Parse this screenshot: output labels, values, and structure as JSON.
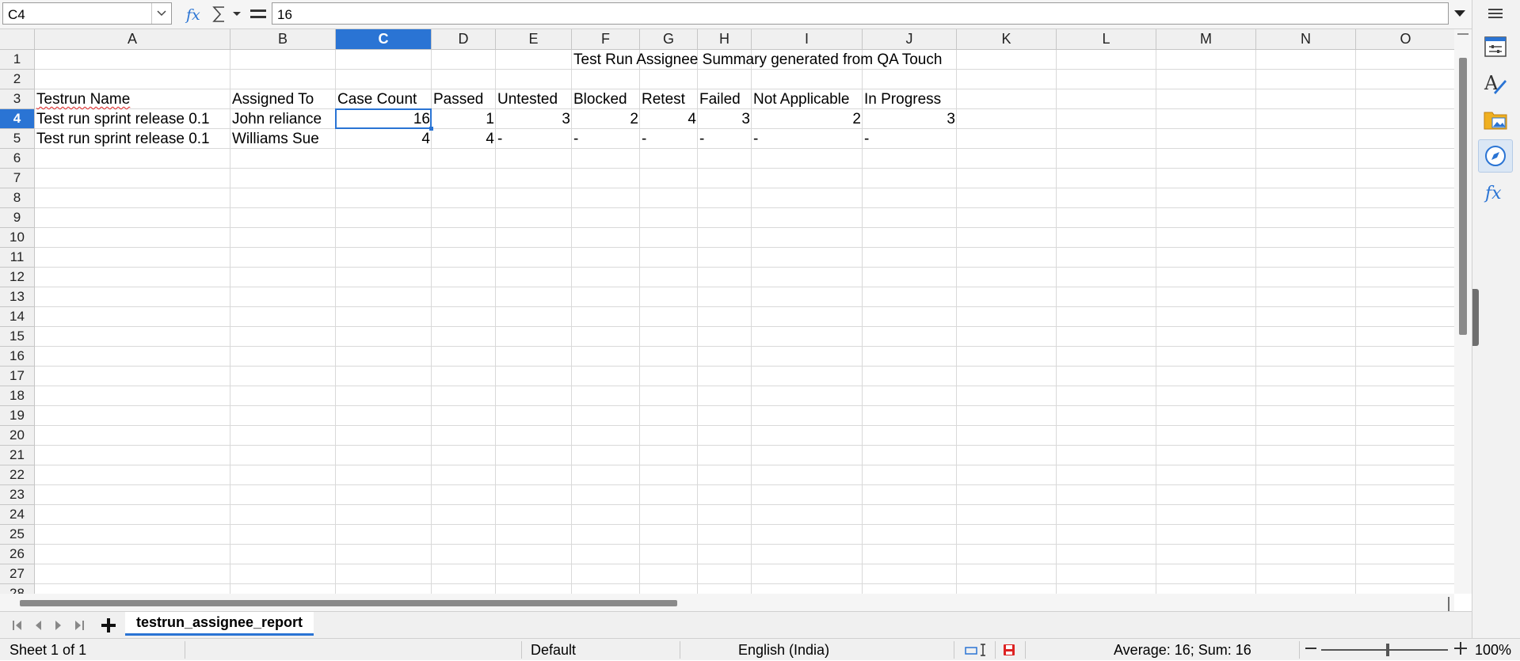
{
  "formula_bar": {
    "cell_ref": "C4",
    "formula_value": "16"
  },
  "columns": [
    "A",
    "B",
    "C",
    "D",
    "E",
    "F",
    "G",
    "H",
    "I",
    "J",
    "K",
    "L",
    "M",
    "N",
    "O"
  ],
  "selected_column": "C",
  "rows": [
    "1",
    "2",
    "3",
    "4",
    "5",
    "6",
    "7",
    "8",
    "9",
    "10",
    "11",
    "12",
    "13",
    "14",
    "15",
    "16",
    "17",
    "18",
    "19",
    "20",
    "21",
    "22",
    "23",
    "24",
    "25",
    "26",
    "27",
    "28"
  ],
  "selected_row": "4",
  "cells": {
    "title": "Test Run Assignee Summary generated from QA Touch",
    "headers": [
      "Testrun Name",
      "Assigned To",
      "Case Count",
      "Passed",
      "Untested",
      "Blocked",
      "Retest",
      "Failed",
      "Not Applicable",
      "In Progress"
    ],
    "data_rows": [
      [
        "Test run sprint release 0.1",
        "John reliance",
        "16",
        "1",
        "3",
        "2",
        "4",
        "3",
        "2",
        "3"
      ],
      [
        "Test run sprint release 0.1",
        "Williams Sue",
        "4",
        "4",
        "-",
        "-",
        "-",
        "-",
        "-",
        "-"
      ]
    ]
  },
  "sheet_tabs": {
    "active": "testrun_assignee_report"
  },
  "status_bar": {
    "sheet_info": "Sheet 1 of 1",
    "page_style": "Default",
    "language": "English (India)",
    "selection_stats": "Average: 16; Sum: 16",
    "zoom": "100%"
  },
  "colors": {
    "accent": "#2a74d4",
    "spell_error": "#e02020"
  },
  "icons": {
    "sidebar": [
      "properties-icon",
      "styles-icon",
      "gallery-icon",
      "navigator-icon",
      "functions-icon"
    ]
  }
}
